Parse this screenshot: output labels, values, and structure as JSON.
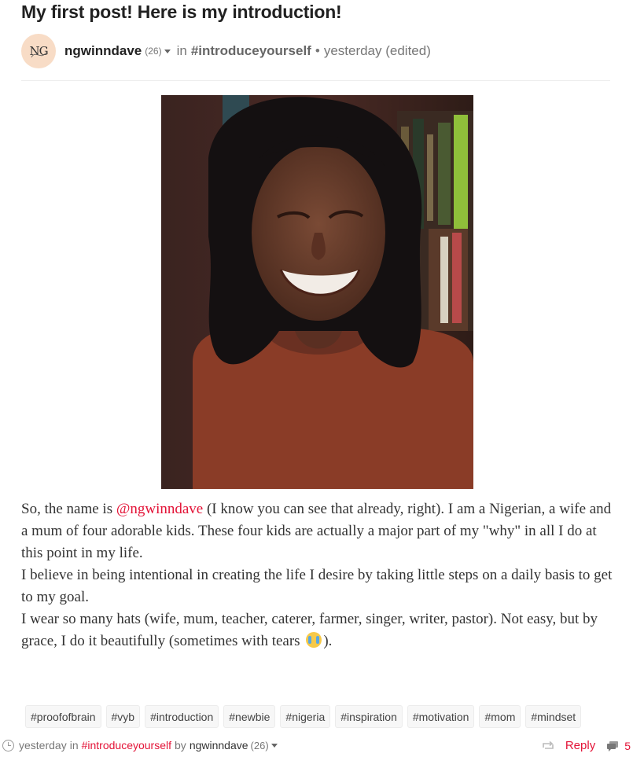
{
  "post": {
    "title": "My first post! Here is my introduction!"
  },
  "byline": {
    "avatar_initials": "NG",
    "author": "ngwinndave",
    "reputation": "(26)",
    "in_label": "in",
    "community": "#introduceyourself",
    "separator": "•",
    "time": "yesterday (edited)"
  },
  "image": {
    "icon": "photo-of-smiling-woman"
  },
  "body": {
    "p1_before": "So, the name is ",
    "mention": "@ngwinndave",
    "p1_after": " (I know you can see that already, right). I am a Nigerian, a wife and a mum of four adorable kids. These four kids are actually a major part of my \"why\" in all I do at this point in my life.",
    "p2": "I believe in being intentional in creating the life I desire by taking little steps on a daily basis to get to my goal.",
    "p3_before": "I wear so many hats (wife, mum, teacher, caterer, farmer, singer, writer, pastor). Not easy, but by grace, I do it beautifully (sometimes with tears ",
    "p3_after": ").",
    "emoji_icon": "crying-face-icon"
  },
  "tags": [
    "#proofofbrain",
    "#vyb",
    "#introduction",
    "#newbie",
    "#nigeria",
    "#inspiration",
    "#motivation",
    "#mom",
    "#mindset"
  ],
  "footer": {
    "time": "yesterday",
    "in_label": "in",
    "community": "#introduceyourself",
    "by_label": "by",
    "author": "ngwinndave",
    "reputation": "(26)",
    "reply_label": "Reply",
    "comments_count": "5"
  },
  "colors": {
    "accent": "#e31337",
    "avatar_bg": "#f8dcc6",
    "tag_bg": "#f7f7f7"
  }
}
